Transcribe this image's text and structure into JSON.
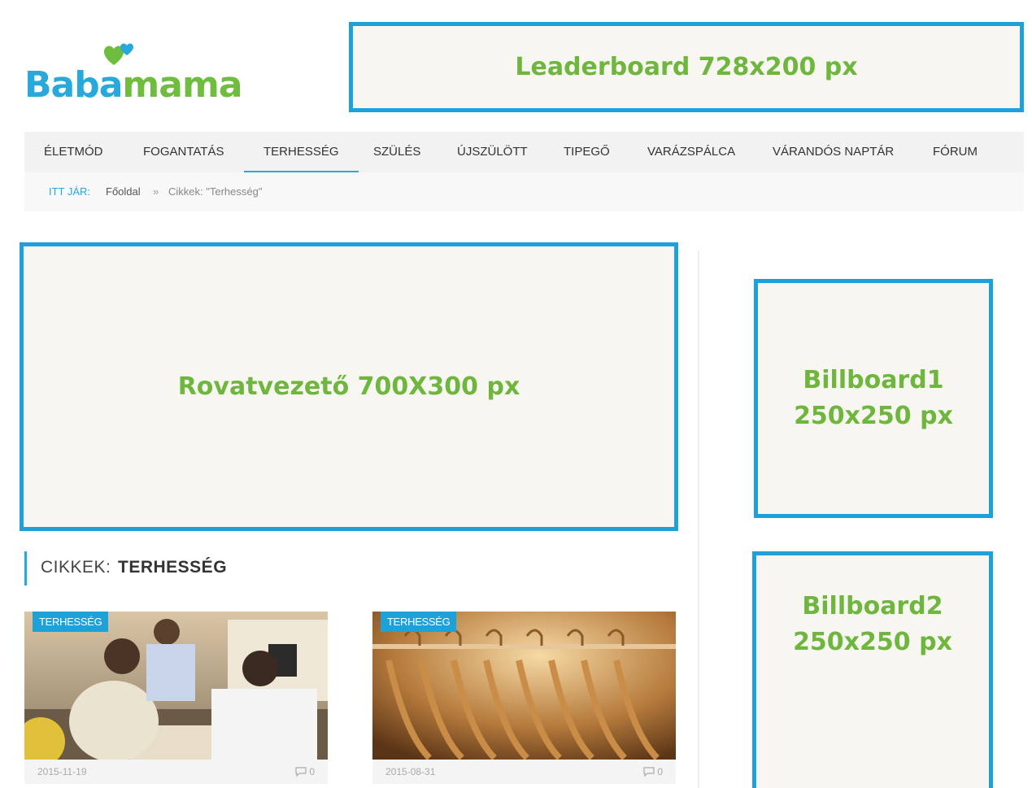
{
  "logo": {
    "part1": "Baba",
    "part2": "mama",
    "heart_color": "#6fbd3f",
    "accent_heart_color": "#27a9dc"
  },
  "ads": {
    "leaderboard": "Leaderboard 728x200 px",
    "rovatvezeto": "Rovatvezető 700X300 px",
    "billboard1_line1": "Billboard1",
    "billboard1_line2": "250x250 px",
    "billboard2_line1": "Billboard2",
    "billboard2_line2": "250x250 px"
  },
  "nav": {
    "items": [
      "ÉLETMÓD",
      "FOGANTATÁS",
      "TERHESSÉG",
      "SZÜLÉS",
      "ÚJSZÜLÖTT",
      "TIPEGŐ",
      "VARÁZSPÁLCA",
      "VÁRANDÓS NAPTÁR",
      "FÓRUM"
    ],
    "active": "TERHESSÉG"
  },
  "breadcrumb": {
    "label": "ITT JÁR:",
    "home": "Főoldal",
    "separator": "»",
    "current": "Cikkek: \"Terhesség\""
  },
  "section": {
    "prefix": "CIKKEK:",
    "title": "TERHESSÉG"
  },
  "articles": [
    {
      "tag": "TERHESSÉG",
      "date": "2015-11-19",
      "comments": "0",
      "image": "doctor consultation photo"
    },
    {
      "tag": "TERHESSÉG",
      "date": "2015-08-31",
      "comments": "0",
      "image": "wooden clothes hangers photo"
    }
  ],
  "colors": {
    "accent": "#1da1d8",
    "ad_text": "#6fb63f",
    "ad_bg": "#f7f6f1"
  }
}
